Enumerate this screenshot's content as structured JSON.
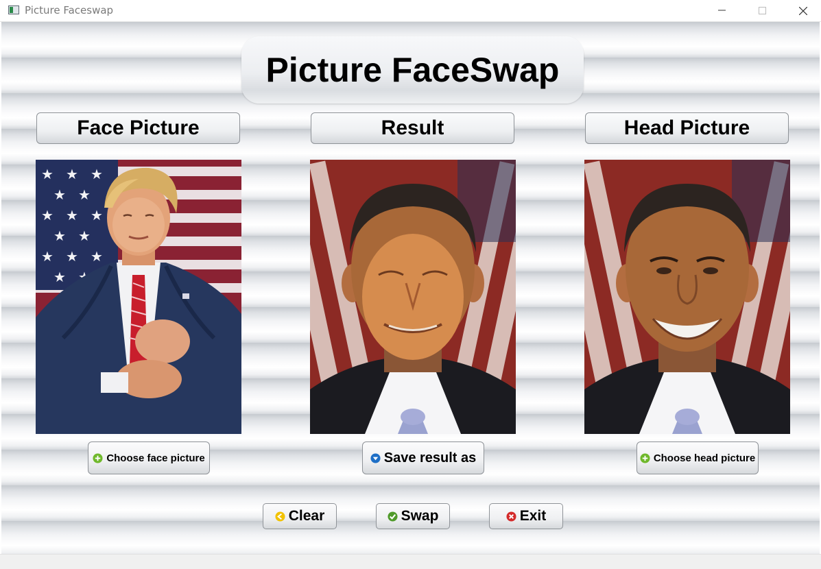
{
  "window": {
    "title": "Picture Faceswap",
    "icon": "app-window-icon",
    "controls": [
      "minimize-icon",
      "maximize-icon",
      "close-icon"
    ]
  },
  "app": {
    "title": "Picture FaceSwap"
  },
  "panels": {
    "face": {
      "header": "Face Picture",
      "button": "Choose face picture",
      "button_icon": "plus-circle-icon",
      "photo": "face-photo"
    },
    "result": {
      "header": "Result",
      "button": "Save result as",
      "button_icon": "download-circle-icon",
      "photo": "result-photo"
    },
    "head": {
      "header": "Head Picture",
      "button": "Choose head picture",
      "button_icon": "plus-circle-icon",
      "photo": "head-photo"
    }
  },
  "actions": {
    "clear": {
      "label": "Clear",
      "icon": "back-arrow-circle-icon"
    },
    "swap": {
      "label": "Swap",
      "icon": "check-circle-icon"
    },
    "exit": {
      "label": "Exit",
      "icon": "x-circle-icon"
    }
  },
  "colors": {
    "plus_icon": "#6fb82b",
    "download_icon": "#1e6fc6",
    "clear_icon": "#f2c200",
    "swap_icon": "#4f9a2a",
    "exit_icon": "#d42b2b"
  }
}
